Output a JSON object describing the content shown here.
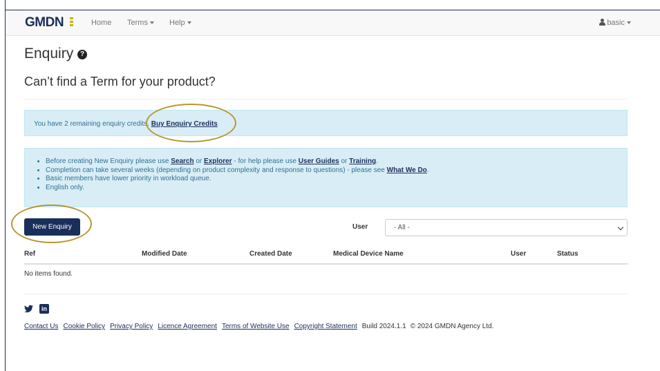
{
  "navbar": {
    "logo_text": "GMDN",
    "links": [
      {
        "label": "Home"
      },
      {
        "label": "Terms"
      },
      {
        "label": "Help"
      }
    ],
    "user_label": "basic"
  },
  "page": {
    "title": "Enquiry",
    "help_icon_glyph": "?",
    "subtitle": "Can’t find a Term for your product?"
  },
  "credits_alert": {
    "text": "You have 2 remaining enquiry credits.",
    "link": "Buy Enquiry Credits"
  },
  "info_alert": {
    "item1": {
      "t1": "Before creating New Enquiry please use ",
      "search": "Search",
      "t2": " or ",
      "explorer": "Explorer",
      "t3": " - for help please use ",
      "guides": "User Guides",
      "t4": " or ",
      "training": "Training",
      "t5": "."
    },
    "item2": {
      "t1": "Completion can take several weeks (depending on product complexity and response to questions) - please see ",
      "whatwedo": "What We Do",
      "t2": "."
    },
    "item3": "Basic members have lower priority in workload queue.",
    "item4": "English only."
  },
  "toolbar": {
    "new_enquiry_label": "New Enquiry",
    "user_filter_label": "User",
    "user_filter_value": "- All -"
  },
  "table": {
    "columns": [
      "Ref",
      "Modified Date",
      "Created Date",
      "Medical Device Name",
      "User",
      "Status"
    ],
    "empty_text": "No items found."
  },
  "social": {
    "twitter_icon": "twitter-icon",
    "linkedin_glyph": "in"
  },
  "footer": {
    "links": [
      "Contact Us",
      "Cookie Policy",
      "Privacy Policy",
      "Licence Agreement",
      "Terms of Website Use",
      "Copyright Statement"
    ],
    "build": "Build 2024.1.1",
    "copyright": "© 2024 GMDN Agency Ltd."
  },
  "colors": {
    "brand": "#1a2e5a",
    "alert_bg": "#d9edf7",
    "highlight": "#b8962e"
  }
}
